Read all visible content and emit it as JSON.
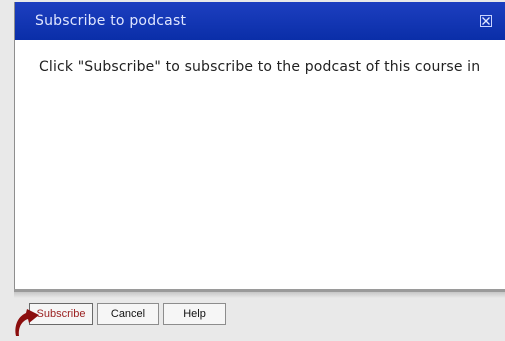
{
  "dialog": {
    "title": "Subscribe to podcast",
    "close_icon": "close-icon",
    "message": "Click \"Subscribe\" to subscribe to the podcast of this course in"
  },
  "buttons": {
    "subscribe_label": "Subscribe",
    "cancel_label": "Cancel",
    "help_label": "Help"
  },
  "colors": {
    "titlebar": "#0a2ea8",
    "title_text": "#dfe6ff",
    "pointer_arrow": "#8b0d0d",
    "subscribe_text": "#9a1f1f"
  }
}
